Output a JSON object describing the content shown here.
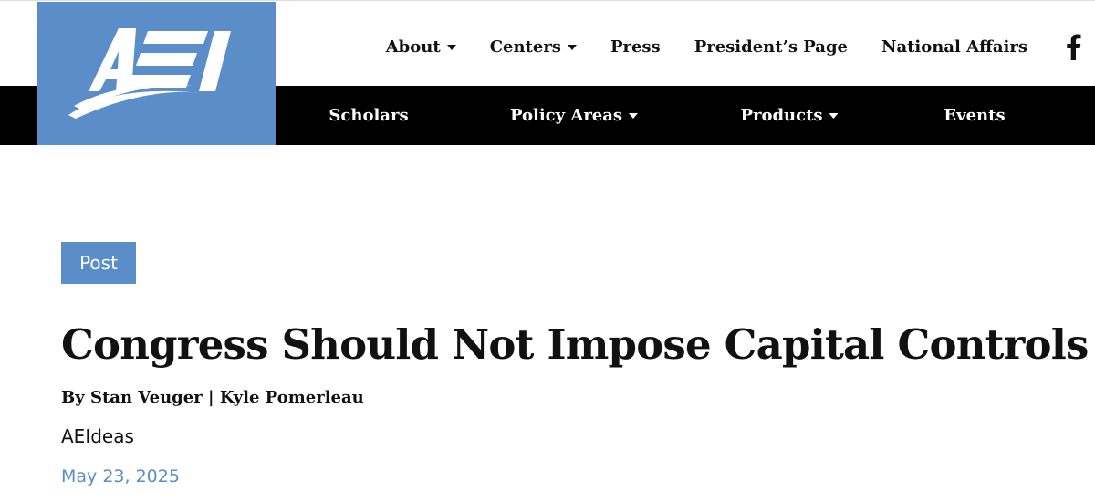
{
  "logo": {
    "text": "AEI",
    "bg_color": "#5b8dc9"
  },
  "top_nav": {
    "items": [
      {
        "label": "About",
        "has_dropdown": true
      },
      {
        "label": "Centers",
        "has_dropdown": true
      },
      {
        "label": "Press",
        "has_dropdown": false
      },
      {
        "label": "President’s Page",
        "has_dropdown": false
      },
      {
        "label": "National Affairs",
        "has_dropdown": false
      }
    ],
    "social_icon": "facebook-icon"
  },
  "main_nav": {
    "bg_color": "#000000",
    "items": [
      {
        "label": "Scholars",
        "has_dropdown": false
      },
      {
        "label": "Policy Areas",
        "has_dropdown": true
      },
      {
        "label": "Products",
        "has_dropdown": true
      },
      {
        "label": "Events",
        "has_dropdown": false
      }
    ]
  },
  "article": {
    "tag": "Post",
    "title": "Congress Should Not Impose Capital Controls",
    "byline_prefix": "By",
    "authors": [
      "Stan Veuger",
      "Kyle Pomerleau"
    ],
    "author_separator": "|",
    "series": "AEIdeas",
    "date": "May 23, 2025",
    "accent_color": "#5b8dc9"
  }
}
